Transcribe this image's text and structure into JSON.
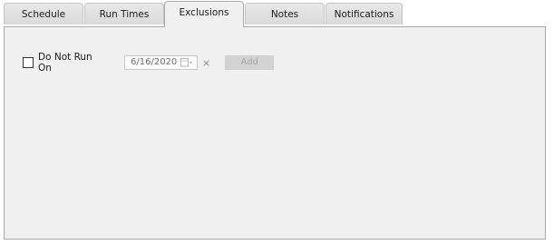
{
  "tabs": [
    {
      "label": "Schedule",
      "active": false
    },
    {
      "label": "Run Times",
      "active": false
    },
    {
      "label": "Exclusions",
      "active": true
    },
    {
      "label": "Notes",
      "active": false
    },
    {
      "label": "Notifications",
      "active": false
    }
  ],
  "exclusions": {
    "checkbox_label": "Do Not Run On",
    "checked": false,
    "date_value": "6/16/2020",
    "calendar_icon": "calendar-icon",
    "clear_glyph": "×",
    "add_label": "Add",
    "add_enabled": false
  },
  "colors": {
    "panel_bg": "#f0f0f0",
    "tab_bg": "#dadada",
    "border": "#a9a9a9",
    "disabled_text": "#a3a3a3"
  }
}
